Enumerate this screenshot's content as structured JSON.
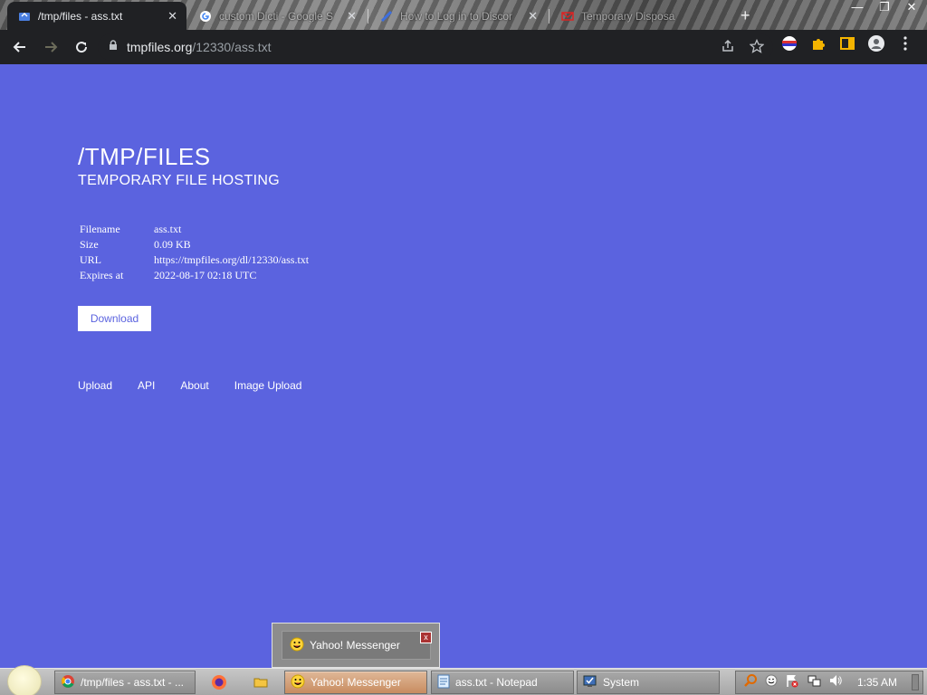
{
  "browser": {
    "tabs": [
      {
        "title": "/tmp/files - ass.txt",
        "active": true,
        "icon": "upload-favicon-icon"
      },
      {
        "title": "custom Dicti - Google S",
        "active": false,
        "icon": "google-icon"
      },
      {
        "title": "How to Log in to Discor",
        "active": false,
        "icon": "discord-guide-icon"
      },
      {
        "title": "Temporary Disposa",
        "active": false,
        "icon": "mail-icon"
      }
    ],
    "close_glyph": "✕",
    "new_tab_glyph": "+",
    "window_controls": {
      "minimize": "—",
      "restore": "❐",
      "close": "✕"
    },
    "url_host": "tmpfiles.org",
    "url_path": "/12330/ass.txt"
  },
  "page": {
    "title": "/TMP/FILES",
    "subtitle": "TEMPORARY FILE HOSTING",
    "info": [
      {
        "key": "Filename",
        "value": "ass.txt"
      },
      {
        "key": "Size",
        "value": "0.09 KB"
      },
      {
        "key": "URL",
        "value": "https://tmpfiles.org/dl/12330/ass.txt"
      },
      {
        "key": "Expires at",
        "value": "2022-08-17 02:18 UTC"
      }
    ],
    "download_label": "Download",
    "footer_links": [
      "Upload",
      "API",
      "About",
      "Image Upload"
    ],
    "colors": {
      "background": "#5b63df",
      "text": "#ffffff"
    }
  },
  "notification": {
    "label": "Yahoo! Messenger",
    "close_glyph": "x"
  },
  "taskbar": {
    "items": [
      {
        "label": "/tmp/files - ass.txt - ...",
        "icon": "chrome-icon",
        "active": false
      },
      {
        "label": "Yahoo! Messenger",
        "icon": "yahoo-messenger-icon",
        "active": true
      },
      {
        "label": "ass.txt - Notepad",
        "icon": "notepad-icon",
        "active": false
      },
      {
        "label": "System",
        "icon": "system-icon",
        "active": false
      }
    ],
    "clock": "1:35 AM"
  }
}
